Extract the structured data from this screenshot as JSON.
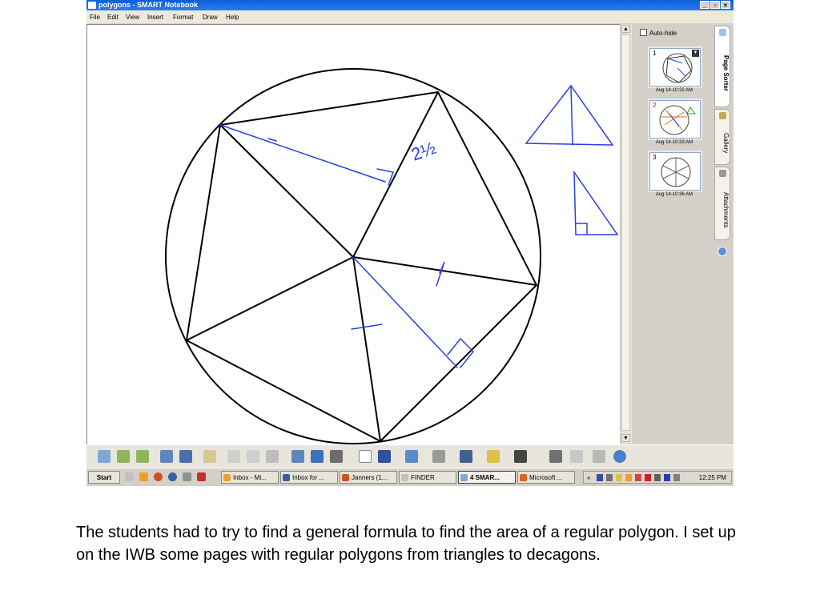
{
  "window": {
    "title": "polygons - SMART Notebook",
    "controls": [
      "_",
      "▫",
      "×"
    ]
  },
  "menu": [
    "File",
    "Edit",
    "View",
    "Insert",
    "Format",
    "Draw",
    "Help"
  ],
  "canvas": {
    "handwritten": {
      "mark_top": "2½"
    }
  },
  "sidebar": {
    "autohide_label": "Auto-hide",
    "pages": [
      {
        "number": "1",
        "date": "Aug 14-10:32 AM"
      },
      {
        "number": "2",
        "date": "Aug 14-10:33 AM"
      },
      {
        "number": "3",
        "date": "Aug 14-10:36 AM"
      }
    ],
    "tabs": [
      "Page Sorter",
      "Gallery",
      "Attachments"
    ]
  },
  "taskbar": {
    "start_label": "Start",
    "buttons": [
      "Inbox - Mi...",
      "Inbox for ...",
      "Janners (1...",
      "FINDER",
      "4 SMAR...",
      "Microsoft ..."
    ],
    "clock": "12:25 PM"
  },
  "caption": "The students had to try to find a general formula to find the area of a regular polygon.  I set up on the IWB some pages with regular polygons from triangles to decagons."
}
